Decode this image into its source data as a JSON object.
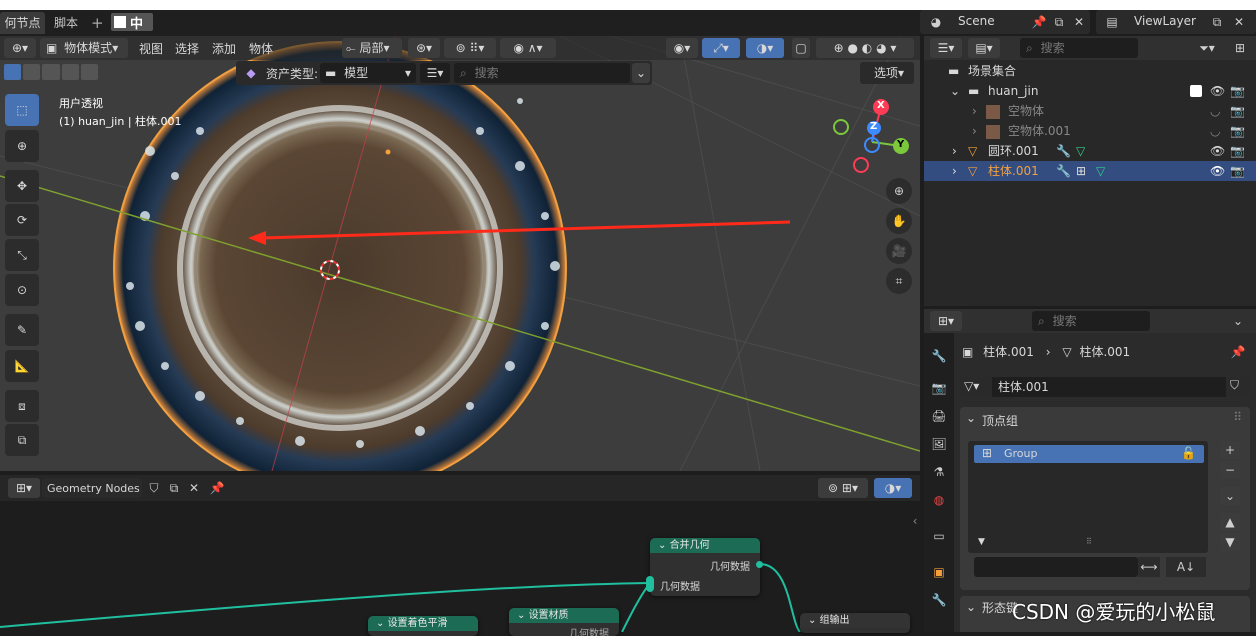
{
  "tabs": {
    "geometry_nodes": "何节点",
    "scripting": "脚本",
    "add": "+",
    "ime": "中"
  },
  "scene": {
    "name": "Scene",
    "view_layer": "ViewLayer"
  },
  "viewport": {
    "header": {
      "mode": "物体模式",
      "view": "视图",
      "select": "选择",
      "add": "添加",
      "object": "物体",
      "transform": "局部"
    },
    "asset_bar": {
      "type_label": "资产类型:",
      "type_value": "模型",
      "search_placeholder": "搜索",
      "options": "选项"
    },
    "overlay": {
      "view_name": "用户透视",
      "object_info": "(1) huan_jin | 柱体.001"
    },
    "gizmo": {
      "x": "X",
      "y": "Y",
      "z": "Z"
    }
  },
  "node_editor": {
    "tree_name": "Geometry Nodes",
    "nodes": [
      {
        "title": "合并几何",
        "output": "几何数据",
        "input": "几何数据"
      },
      {
        "title": "设置着色平滑"
      },
      {
        "title": "设置材质",
        "socket": "几何数据"
      },
      {
        "title": "组输出"
      }
    ]
  },
  "outliner": {
    "search_placeholder": "搜索",
    "items": [
      {
        "label": "场景集合"
      },
      {
        "label": "huan_jin"
      },
      {
        "label": "空物体"
      },
      {
        "label": "空物体.001"
      },
      {
        "label": "圆环.001"
      },
      {
        "label": "柱体.001"
      }
    ]
  },
  "properties": {
    "search_placeholder": "搜索",
    "breadcrumb": {
      "object": "柱体.001",
      "data": "柱体.001"
    },
    "mesh_name": "柱体.001",
    "vertex_groups": {
      "title": "顶点组",
      "items": [
        "Group"
      ]
    },
    "shape_keys": {
      "title": "形态键"
    }
  },
  "watermark": "CSDN @爱玩的小松鼠",
  "colors": {
    "accent": "#4772b3",
    "node_header": "#1c6b55",
    "selection": "#f5a03c",
    "annotation": "#ff2a1a"
  }
}
